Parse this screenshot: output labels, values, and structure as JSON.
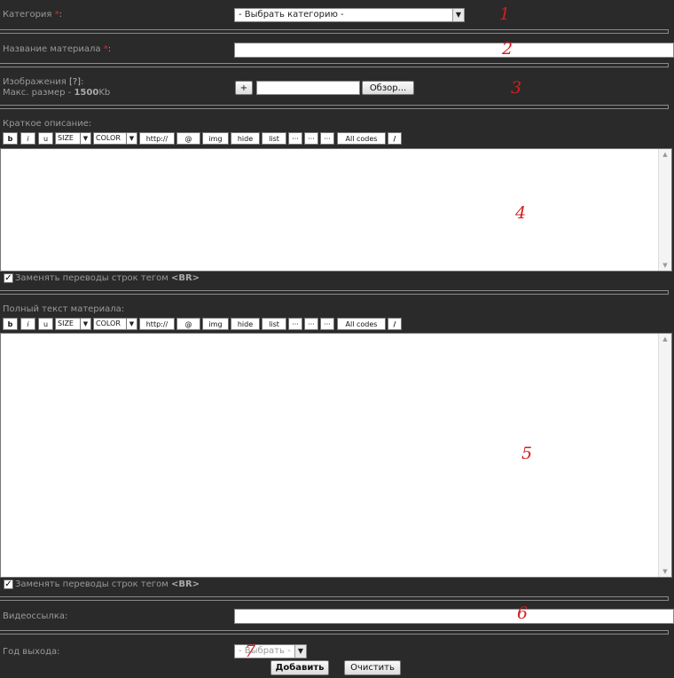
{
  "form": {
    "category": {
      "label": "Категория",
      "required_mark": "*",
      "colon": ":",
      "value": "- Выбрать категорию -"
    },
    "title": {
      "label": "Название материала",
      "required_mark": "*",
      "colon": ":"
    },
    "images": {
      "label": "Изображения",
      "help": "[?]",
      "colon": ":",
      "size_prefix": "Макс. размер - ",
      "size_value": "1500",
      "size_unit": "Kb",
      "add_label": "+",
      "browse_label": "Обзор..."
    },
    "short_desc": {
      "label": "Краткое описание:"
    },
    "full_text": {
      "label": "Полный текст материала:"
    },
    "replace_br": {
      "label": "Заменять переводы строк тегом",
      "tag": "<BR>",
      "checked": true
    },
    "video": {
      "label": "Видеоссылка:"
    },
    "year": {
      "label": "Год выхода:",
      "value": "- Выбрать -"
    },
    "buttons": {
      "submit": "Добавить",
      "reset": "Очистить"
    }
  },
  "toolbar": {
    "bold": "b",
    "italic": "i",
    "underline": "u",
    "size": "SIZE",
    "color": "COLOR",
    "http": "http://",
    "email": "@",
    "img": "img",
    "hide": "hide",
    "list": "list",
    "dots1": "···",
    "dots2": "···",
    "dots3": "···",
    "all_codes": "All codes",
    "close": "/"
  },
  "annotations": [
    "1",
    "2",
    "3",
    "4",
    "5",
    "6",
    "7"
  ],
  "icons": {
    "dropdown": "chevron-down-icon",
    "checkbox": "checkmark-icon",
    "scroll_up": "scroll-up-arrow-icon",
    "scroll_down": "scroll-down-arrow-icon"
  }
}
